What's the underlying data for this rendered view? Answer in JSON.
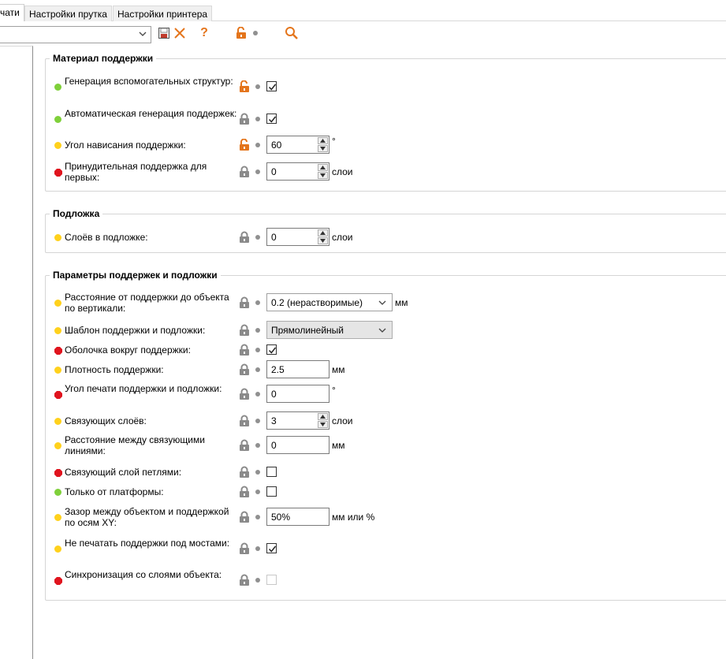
{
  "tabs": [
    {
      "label": "чати",
      "active": true
    },
    {
      "label": "Настройки прутка",
      "active": false
    },
    {
      "label": "Настройки принтера",
      "active": false
    }
  ],
  "toolbar": {
    "preset_value": "",
    "icons": [
      "save-icon",
      "delete-icon",
      "help-icon",
      "unlock-icon",
      "search-icon"
    ],
    "help_glyph": "?"
  },
  "colors": {
    "green": "#7fd03a",
    "yellow": "#ffd11c",
    "red": "#e0141e",
    "unlock": "#e4751c",
    "lock": "#8a8a8a"
  },
  "groups": [
    {
      "title": "Материал поддержки",
      "rows": [
        {
          "status": "green",
          "label": "Генерация вспомогательных структур:",
          "lock": "open",
          "control": "checkbox",
          "checked": true
        },
        {
          "status": "green",
          "label": "Автоматическая генерация поддержек:",
          "lock": "closed",
          "control": "checkbox",
          "checked": true
        },
        {
          "status": "yellow",
          "label": "Угол нависания поддержки:",
          "lock": "open",
          "control": "spin",
          "value": "60",
          "unit": "°"
        },
        {
          "status": "red",
          "label": "Принудительная поддержка для первых:",
          "lock": "closed",
          "control": "spin",
          "value": "0",
          "unit": "слои"
        }
      ]
    },
    {
      "title": "Подложка",
      "rows": [
        {
          "status": "yellow",
          "label": "Слоёв в подложке:",
          "lock": "closed",
          "control": "spin",
          "value": "0",
          "unit": "слои"
        }
      ]
    },
    {
      "title": "Параметры поддержек и подложки",
      "rows": [
        {
          "status": "yellow",
          "label": "Расстояние от поддержки до объекта по вертикали:",
          "lock": "closed",
          "control": "dropdown",
          "value": "0.2 (нерастворимые)",
          "unit": "мм"
        },
        {
          "status": "yellow",
          "label": "Шаблон поддержки и подложки:",
          "lock": "closed",
          "control": "dropdown-gray",
          "value": "Прямолинейный",
          "unit": ""
        },
        {
          "status": "red",
          "label": "Оболочка вокруг поддержки:",
          "lock": "closed",
          "control": "checkbox",
          "checked": true
        },
        {
          "status": "yellow",
          "label": "Плотность поддержки:",
          "lock": "closed",
          "control": "text",
          "value": "2.5",
          "unit": "мм"
        },
        {
          "status": "red",
          "label": "Угол печати поддержки и подложки:",
          "lock": "closed",
          "control": "text",
          "value": "0",
          "unit": "°"
        },
        {
          "status": "yellow",
          "label": "Связующих слоёв:",
          "lock": "closed",
          "control": "spin",
          "value": "3",
          "unit": "слои"
        },
        {
          "status": "yellow",
          "label": "Расстояние между связующими линиями:",
          "lock": "closed",
          "control": "text",
          "value": "0",
          "unit": "мм"
        },
        {
          "status": "red",
          "label": "Связующий слой петлями:",
          "lock": "closed",
          "control": "checkbox",
          "checked": false
        },
        {
          "status": "green",
          "label": "Только от платформы:",
          "lock": "closed",
          "control": "checkbox",
          "checked": false
        },
        {
          "status": "yellow",
          "label": "Зазор между объектом и поддержкой по осям XY:",
          "lock": "closed",
          "control": "text",
          "value": "50%",
          "unit": "мм или %"
        },
        {
          "status": "yellow",
          "label": "Не печатать поддержки под мостами:",
          "lock": "closed",
          "control": "checkbox",
          "checked": true
        },
        {
          "status": "red",
          "label": "Синхронизация со слоями объекта:",
          "lock": "closed",
          "control": "checkbox-disabled",
          "checked": false
        }
      ]
    }
  ]
}
